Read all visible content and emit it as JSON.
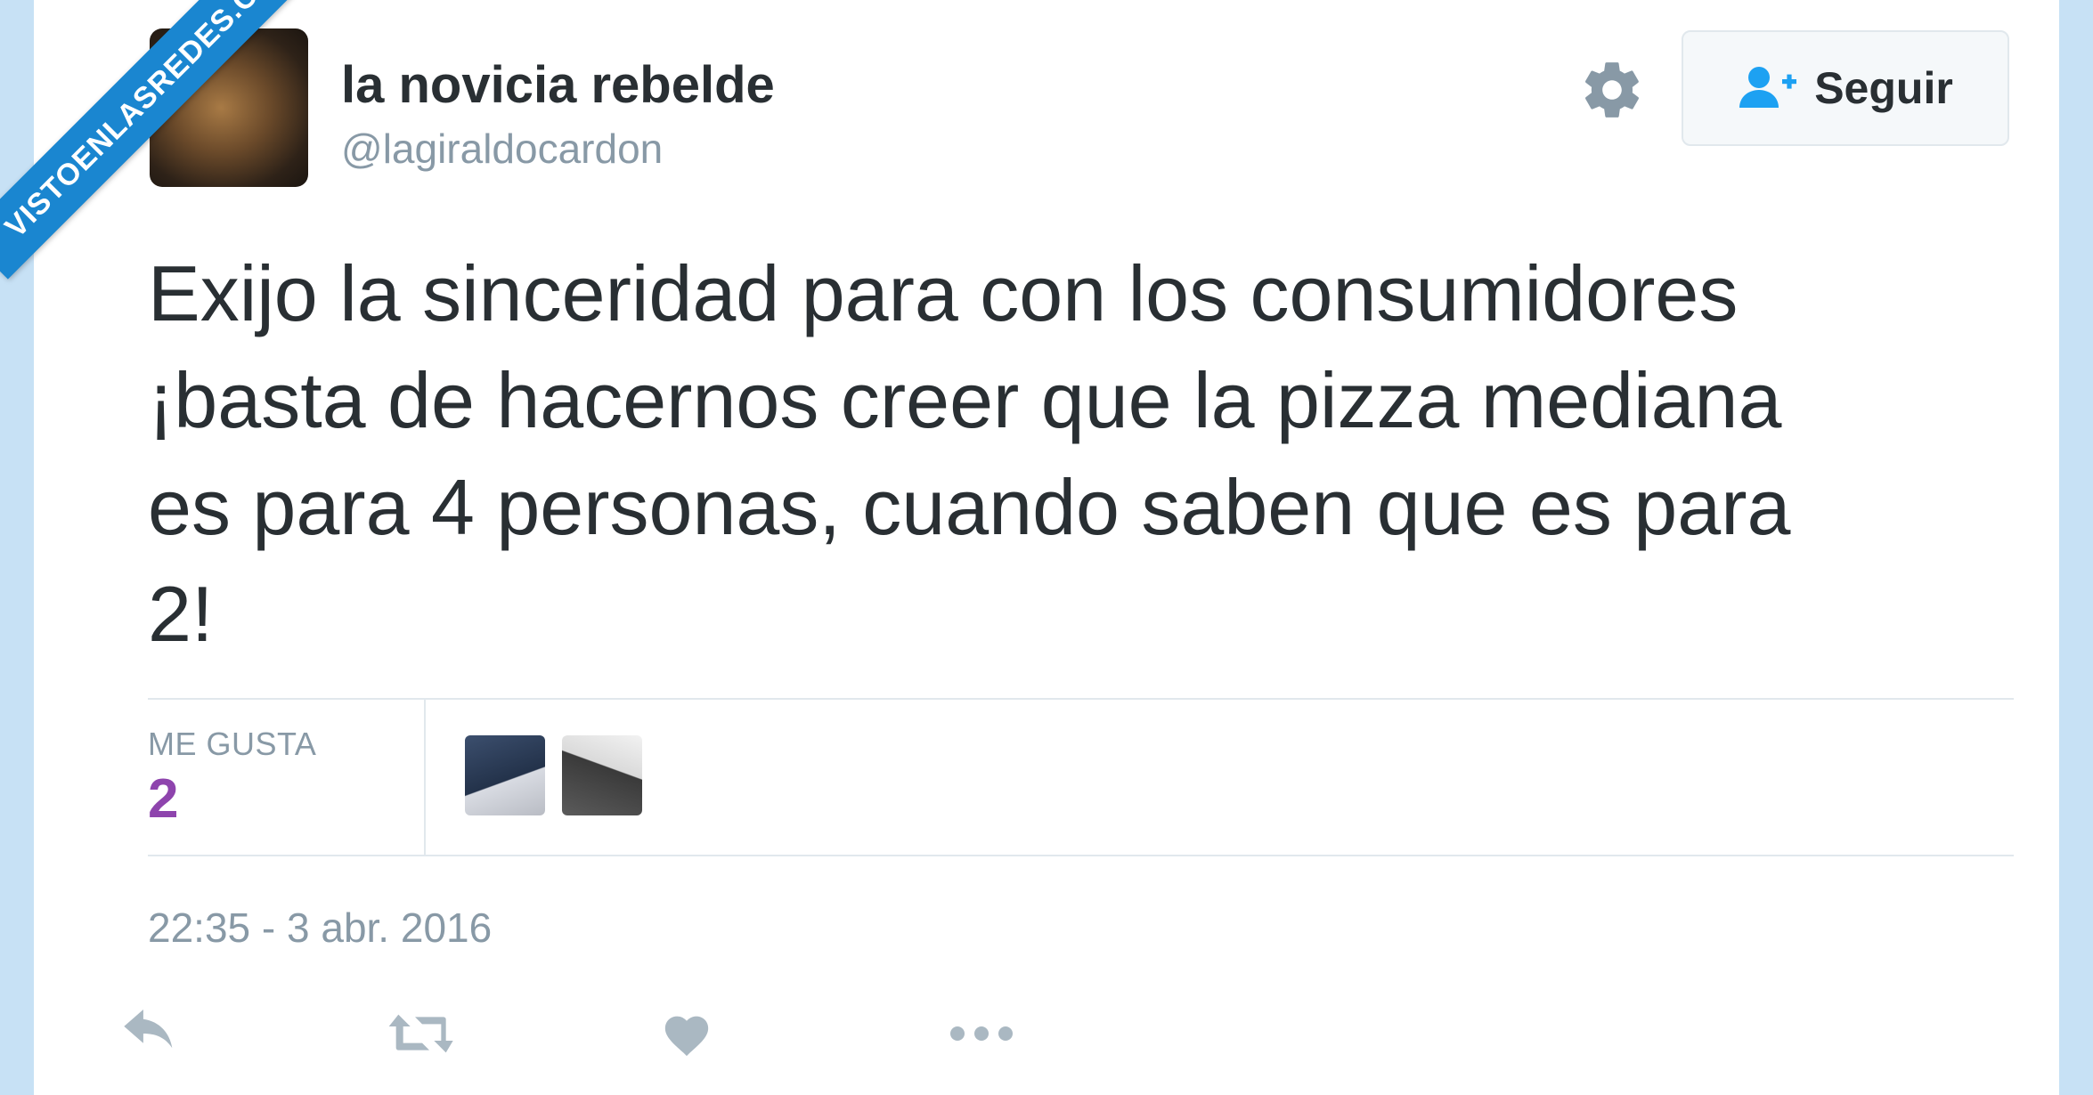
{
  "watermark": {
    "text": "VISTOENLASREDES.COM",
    "color": "#1a86d0"
  },
  "author": {
    "name": "la novicia rebelde",
    "handle": "@lagiraldocardon"
  },
  "header": {
    "settings_icon": "gear-icon",
    "follow_label": "Seguir",
    "follow_icon": "add-user-icon"
  },
  "tweet": {
    "lines": [
      "Exijo la sinceridad para con los consumidores",
      "¡basta de hacernos creer que la pizza mediana",
      "es para 4 personas, cuando saben que es para",
      "2!"
    ]
  },
  "stats": {
    "likes_label": "ME GUSTA",
    "likes_count": "2",
    "likes_color": "#8e44ad"
  },
  "timestamp": "22:35 - 3 abr. 2016",
  "actions": [
    {
      "name": "reply",
      "icon": "reply-icon"
    },
    {
      "name": "retweet",
      "icon": "retweet-icon"
    },
    {
      "name": "like",
      "icon": "heart-icon"
    },
    {
      "name": "more",
      "icon": "more-icon"
    }
  ],
  "colors": {
    "text": "#292f33",
    "muted": "#8899a6",
    "background": "#c7e1f5"
  }
}
